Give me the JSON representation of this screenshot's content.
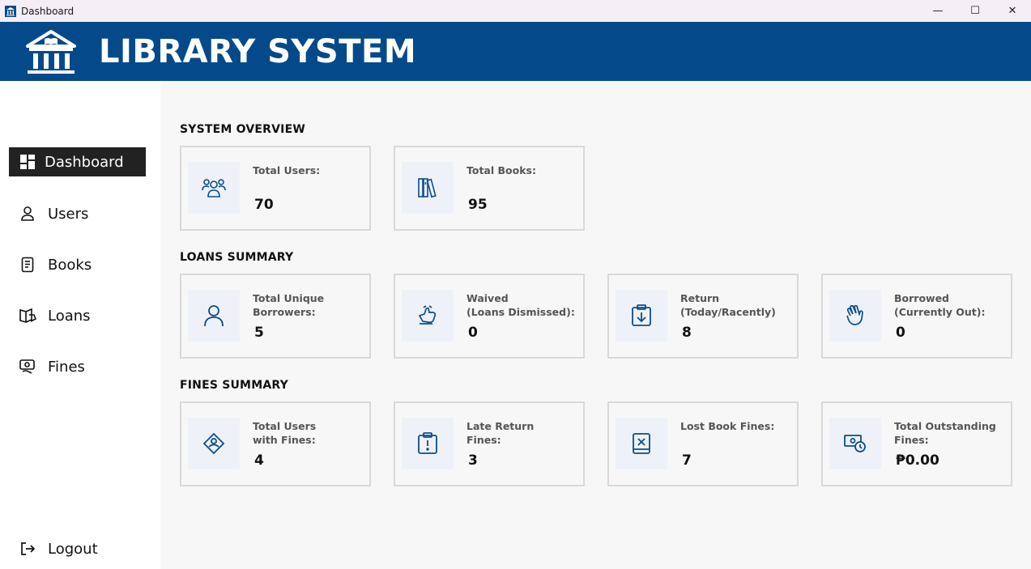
{
  "window": {
    "title": "Dashboard",
    "controls": {
      "minimize": "—",
      "maximize": "☐",
      "close": "✕"
    }
  },
  "header": {
    "brand": "LIBRARY SYSTEM"
  },
  "sidebar": {
    "items": [
      {
        "label": "Dashboard",
        "icon": "dashboard-grid-icon",
        "active": true
      },
      {
        "label": "Users",
        "icon": "user-icon"
      },
      {
        "label": "Books",
        "icon": "book-icon"
      },
      {
        "label": "Loans",
        "icon": "open-book-icon"
      },
      {
        "label": "Fines",
        "icon": "fines-icon"
      }
    ],
    "logout": "Logout"
  },
  "sections": {
    "overview": {
      "title": "SYSTEM OVERVIEW",
      "cards": [
        {
          "label": "Total Users:",
          "value": "70",
          "icon": "users-group-icon"
        },
        {
          "label": "Total Books:",
          "value": "95",
          "icon": "books-shelf-icon"
        }
      ]
    },
    "loans": {
      "title": "LOANS SUMMARY",
      "cards": [
        {
          "label": "Total Unique\nBorrowers:",
          "value": "5",
          "icon": "person-icon"
        },
        {
          "label": "Waived\n(Loans Dismissed):",
          "value": "0",
          "icon": "hand-coin-icon"
        },
        {
          "label": "Return\n(Today/Racently)",
          "value": "8",
          "icon": "clipboard-download-icon"
        },
        {
          "label": "Borrowed\n(Currently Out):",
          "value": "0",
          "icon": "waving-hand-icon"
        }
      ]
    },
    "fines": {
      "title": "FINES SUMMARY",
      "cards": [
        {
          "label": "Total Users\nwith Fines:",
          "value": "4",
          "icon": "diamond-user-icon"
        },
        {
          "label": "Late Return\nFines:",
          "value": "3",
          "icon": "clipboard-alert-icon"
        },
        {
          "label": "Lost Book Fines:",
          "value": "7",
          "icon": "book-x-icon"
        },
        {
          "label": "Total Outstanding\nFines:",
          "value": "₱0.00",
          "icon": "money-clock-icon"
        }
      ]
    }
  },
  "colors": {
    "header": "#044a8a",
    "active_nav": "#222222",
    "icon": "#0b4d8c"
  }
}
